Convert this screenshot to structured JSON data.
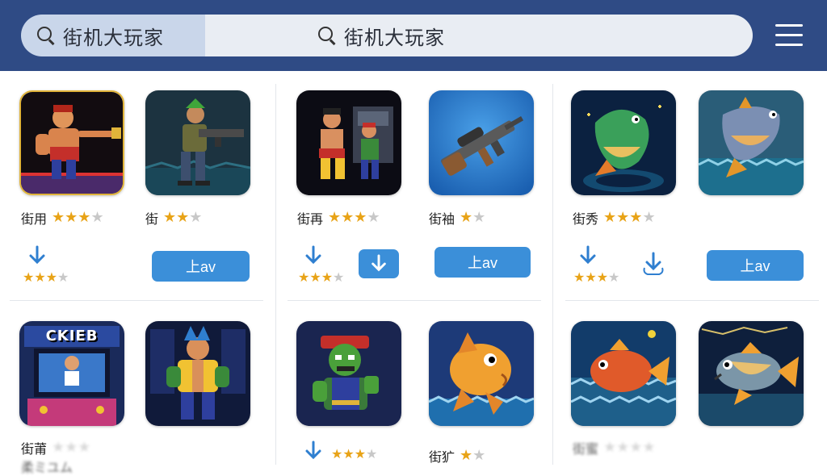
{
  "header": {
    "search_tab_text": "街机大玩家",
    "search_field_text": "街机大玩家"
  },
  "cards": [
    {
      "name_a": "街用",
      "stars_a": 3,
      "name_b": "街",
      "stars_b": 2,
      "bottom_stars": 3,
      "button_label": "上av"
    },
    {
      "name_a": "街再",
      "stars_a": 3,
      "name_b": "街袖",
      "stars_b": 1,
      "bottom_stars": 3,
      "button_label": "上av"
    },
    {
      "name_a": "街秀",
      "stars_a": 3,
      "bottom_stars": 3,
      "button_label": "上av"
    }
  ],
  "row2": {
    "c1_name": "街莆",
    "c1_text2": "柔ミユム",
    "c2_name": "街犷",
    "c3_name": "街蜜"
  },
  "arcade_marquee": "CKIEB",
  "colors": {
    "header": "#2f4b85",
    "button": "#3b8fd9",
    "star": "#e8a317"
  }
}
